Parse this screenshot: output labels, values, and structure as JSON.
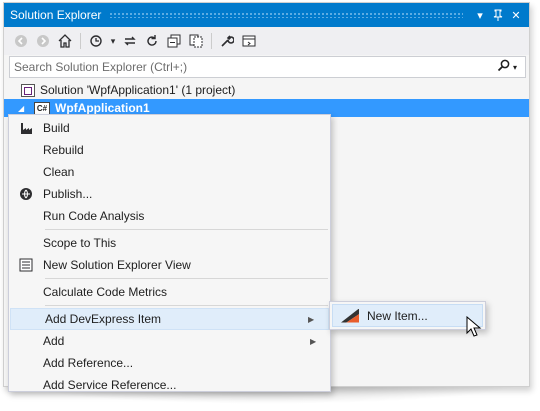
{
  "window": {
    "title": "Solution Explorer",
    "pin_glyph": "▾",
    "autohide_glyph": "⊥",
    "close_glyph": "✕"
  },
  "toolbar": {
    "icons": [
      "back-icon",
      "forward-icon",
      "home-icon",
      "history-icon",
      "sync-icon",
      "refresh-icon",
      "collapse-all-icon",
      "show-all-files-icon",
      "properties-icon",
      "preview-icon"
    ]
  },
  "search": {
    "placeholder": "Search Solution Explorer (Ctrl+;)"
  },
  "tree": {
    "solution_label": "Solution 'WpfApplication1' (1 project)",
    "project_label": "WpfApplication1",
    "project_badge": "C#"
  },
  "context_menu": {
    "items": [
      {
        "label": "Build",
        "icon": "build-icon"
      },
      {
        "label": "Rebuild"
      },
      {
        "label": "Clean"
      },
      {
        "label": "Publish...",
        "icon": "publish-icon"
      },
      {
        "label": "Run Code Analysis"
      },
      {
        "label": "Scope to This"
      },
      {
        "label": "New Solution Explorer View",
        "icon": "new-view-icon"
      },
      {
        "label": "Calculate Code Metrics"
      },
      {
        "label": "Add DevExpress Item",
        "submenu": true
      },
      {
        "label": "Add",
        "submenu": true
      },
      {
        "label": "Add Reference..."
      },
      {
        "label": "Add Service Reference..."
      }
    ]
  },
  "submenu": {
    "items": [
      {
        "label": "New Item...",
        "icon": "devexpress-icon"
      }
    ]
  },
  "colors": {
    "accent": "#007acc",
    "selection": "#3399ff",
    "menu_hover": "#e0edfa"
  }
}
